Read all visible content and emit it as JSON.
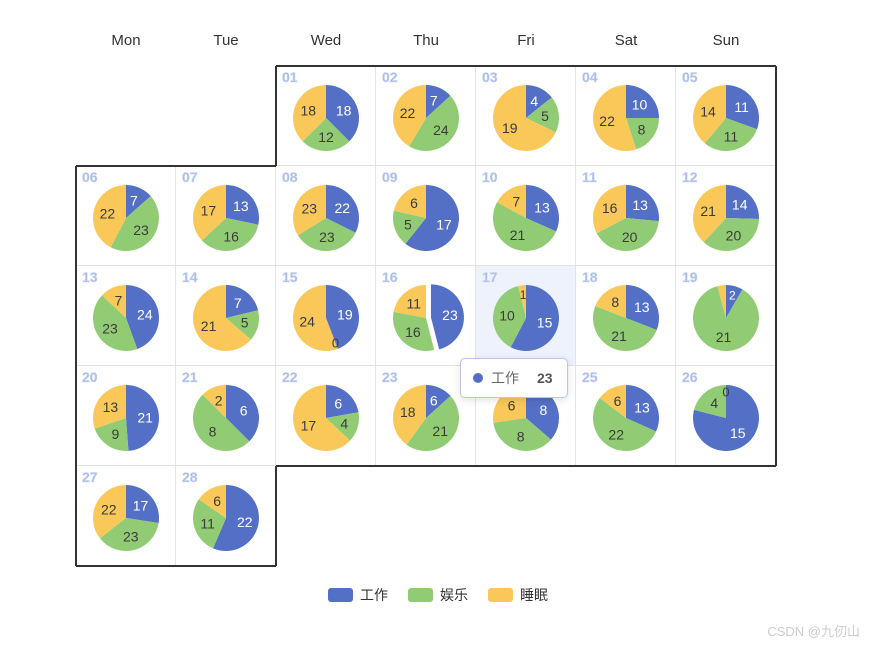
{
  "weekdays": [
    "Mon",
    "Tue",
    "Wed",
    "Thu",
    "Fri",
    "Sat",
    "Sun"
  ],
  "legend": {
    "items": [
      {
        "label": "工作",
        "color": "#5470c6"
      },
      {
        "label": "娱乐",
        "color": "#91cc75"
      },
      {
        "label": "睡眠",
        "color": "#fac858"
      }
    ]
  },
  "tooltip": {
    "series_name": "工作",
    "value": "23",
    "dot_color": "#5470c6"
  },
  "watermark": "CSDN @九仞山",
  "colors": {
    "work": "#5470c6",
    "fun": "#91cc75",
    "sleep": "#fac858",
    "day_number": "#a8bbe8",
    "grid_line": "#e3e3e3",
    "month_outline": "#333333",
    "highlight_cell": "#eef2fc"
  },
  "chart_data": {
    "type": "pie",
    "title": "",
    "description": "Calendar of daily pie charts — hours per activity",
    "categories": [
      "工作",
      "娱乐",
      "睡眠"
    ],
    "category_colors": [
      "#5470c6",
      "#91cc75",
      "#fac858"
    ],
    "legend_position": "bottom",
    "highlighted_day": "16",
    "highlighted_slice": "工作",
    "days": [
      {
        "day": "01",
        "col": 2,
        "row": 0,
        "work": 18,
        "fun": 12,
        "sleep": 18,
        "labels": {
          "work": "18",
          "fun": "12",
          "sleep": "18"
        }
      },
      {
        "day": "02",
        "col": 3,
        "row": 0,
        "work": 7,
        "fun": 24,
        "sleep": 22,
        "labels": {
          "work": "7",
          "fun": "24",
          "sleep": "22"
        }
      },
      {
        "day": "03",
        "col": 4,
        "row": 0,
        "work": 4,
        "fun": 5,
        "sleep": 19,
        "labels": {
          "work": "4",
          "fun": "5",
          "sleep": "19"
        }
      },
      {
        "day": "04",
        "col": 5,
        "row": 0,
        "work": 10,
        "fun": 8,
        "sleep": 22,
        "labels": {
          "work": "10",
          "fun": "8",
          "sleep": "22"
        }
      },
      {
        "day": "05",
        "col": 6,
        "row": 0,
        "work": 11,
        "fun": 11,
        "sleep": 14,
        "labels": {
          "work": "11",
          "fun": "11",
          "sleep": "14"
        }
      },
      {
        "day": "06",
        "col": 0,
        "row": 1,
        "work": 7,
        "fun": 23,
        "sleep": 22,
        "labels": {
          "work": "7",
          "fun": "23",
          "sleep": "22"
        }
      },
      {
        "day": "07",
        "col": 1,
        "row": 1,
        "work": 13,
        "fun": 16,
        "sleep": 17,
        "labels": {
          "work": "13",
          "fun": "16",
          "sleep": "17"
        }
      },
      {
        "day": "08",
        "col": 2,
        "row": 1,
        "work": 22,
        "fun": 23,
        "sleep": 23,
        "labels": {
          "work": "22",
          "fun": "23",
          "sleep": "23"
        }
      },
      {
        "day": "09",
        "col": 3,
        "row": 1,
        "work": 17,
        "fun": 5,
        "sleep": 6,
        "labels": {
          "work": "17",
          "fun": "5",
          "sleep": "6"
        }
      },
      {
        "day": "10",
        "col": 4,
        "row": 1,
        "work": 13,
        "fun": 21,
        "sleep": 7,
        "labels": {
          "work": "13",
          "fun": "21",
          "sleep": "7"
        }
      },
      {
        "day": "11",
        "col": 5,
        "row": 1,
        "work": 13,
        "fun": 20,
        "sleep": 16,
        "labels": {
          "work": "13",
          "fun": "20",
          "sleep": "16"
        }
      },
      {
        "day": "12",
        "col": 6,
        "row": 1,
        "work": 14,
        "fun": 20,
        "sleep": 21,
        "labels": {
          "work": "14",
          "fun": "20",
          "sleep": "21"
        }
      },
      {
        "day": "13",
        "col": 0,
        "row": 2,
        "work": 24,
        "fun": 23,
        "sleep": 7,
        "labels": {
          "work": "24",
          "fun": "23",
          "sleep": "7"
        }
      },
      {
        "day": "14",
        "col": 1,
        "row": 2,
        "work": 7,
        "fun": 5,
        "sleep": 21,
        "labels": {
          "work": "7",
          "fun": "5",
          "sleep": "21"
        }
      },
      {
        "day": "15",
        "col": 2,
        "row": 2,
        "work": 19,
        "fun": 0,
        "sleep": 24,
        "labels": {
          "work": "19",
          "fun": "0",
          "sleep": "24"
        }
      },
      {
        "day": "16",
        "col": 3,
        "row": 2,
        "work": 23,
        "fun": 16,
        "sleep": 11,
        "labels": {
          "work": "23",
          "fun": "16",
          "sleep": "11"
        },
        "exploded": "work"
      },
      {
        "day": "17",
        "col": 4,
        "row": 2,
        "work": 15,
        "fun": 10,
        "sleep": 1,
        "labels": {
          "work": "15",
          "fun": "10",
          "sleep": "1"
        },
        "highlight": true
      },
      {
        "day": "18",
        "col": 5,
        "row": 2,
        "work": 13,
        "fun": 21,
        "sleep": 8,
        "labels": {
          "work": "13",
          "fun": "21",
          "sleep": "8"
        }
      },
      {
        "day": "19",
        "col": 6,
        "row": 2,
        "work": 2,
        "fun": 21,
        "sleep": 1,
        "labels": {
          "work": "2",
          "fun": "21",
          "sleep": ""
        }
      },
      {
        "day": "20",
        "col": 0,
        "row": 3,
        "work": 21,
        "fun": 9,
        "sleep": 13,
        "labels": {
          "work": "21",
          "fun": "9",
          "sleep": "13"
        }
      },
      {
        "day": "21",
        "col": 1,
        "row": 3,
        "work": 6,
        "fun": 8,
        "sleep": 2,
        "labels": {
          "work": "6",
          "fun": "8",
          "sleep": "2"
        }
      },
      {
        "day": "22",
        "col": 2,
        "row": 3,
        "work": 6,
        "fun": 4,
        "sleep": 17,
        "labels": {
          "work": "6",
          "fun": "4",
          "sleep": "17"
        }
      },
      {
        "day": "23",
        "col": 3,
        "row": 3,
        "work": 6,
        "fun": 21,
        "sleep": 18,
        "labels": {
          "work": "6",
          "fun": "21",
          "sleep": "18"
        }
      },
      {
        "day": "24",
        "col": 4,
        "row": 3,
        "work": 8,
        "fun": 8,
        "sleep": 6,
        "labels": {
          "work": "8",
          "fun": "8",
          "sleep": "6"
        }
      },
      {
        "day": "25",
        "col": 5,
        "row": 3,
        "work": 13,
        "fun": 22,
        "sleep": 6,
        "labels": {
          "work": "13",
          "fun": "22",
          "sleep": "6"
        }
      },
      {
        "day": "26",
        "col": 6,
        "row": 3,
        "work": 15,
        "fun": 4,
        "sleep": 0,
        "labels": {
          "work": "15",
          "fun": "4",
          "sleep": "0"
        }
      },
      {
        "day": "27",
        "col": 0,
        "row": 4,
        "work": 17,
        "fun": 23,
        "sleep": 22,
        "labels": {
          "work": "17",
          "fun": "23",
          "sleep": "22"
        }
      },
      {
        "day": "28",
        "col": 1,
        "row": 4,
        "work": 22,
        "fun": 11,
        "sleep": 6,
        "labels": {
          "work": "22",
          "fun": "11",
          "sleep": "6"
        }
      }
    ]
  }
}
